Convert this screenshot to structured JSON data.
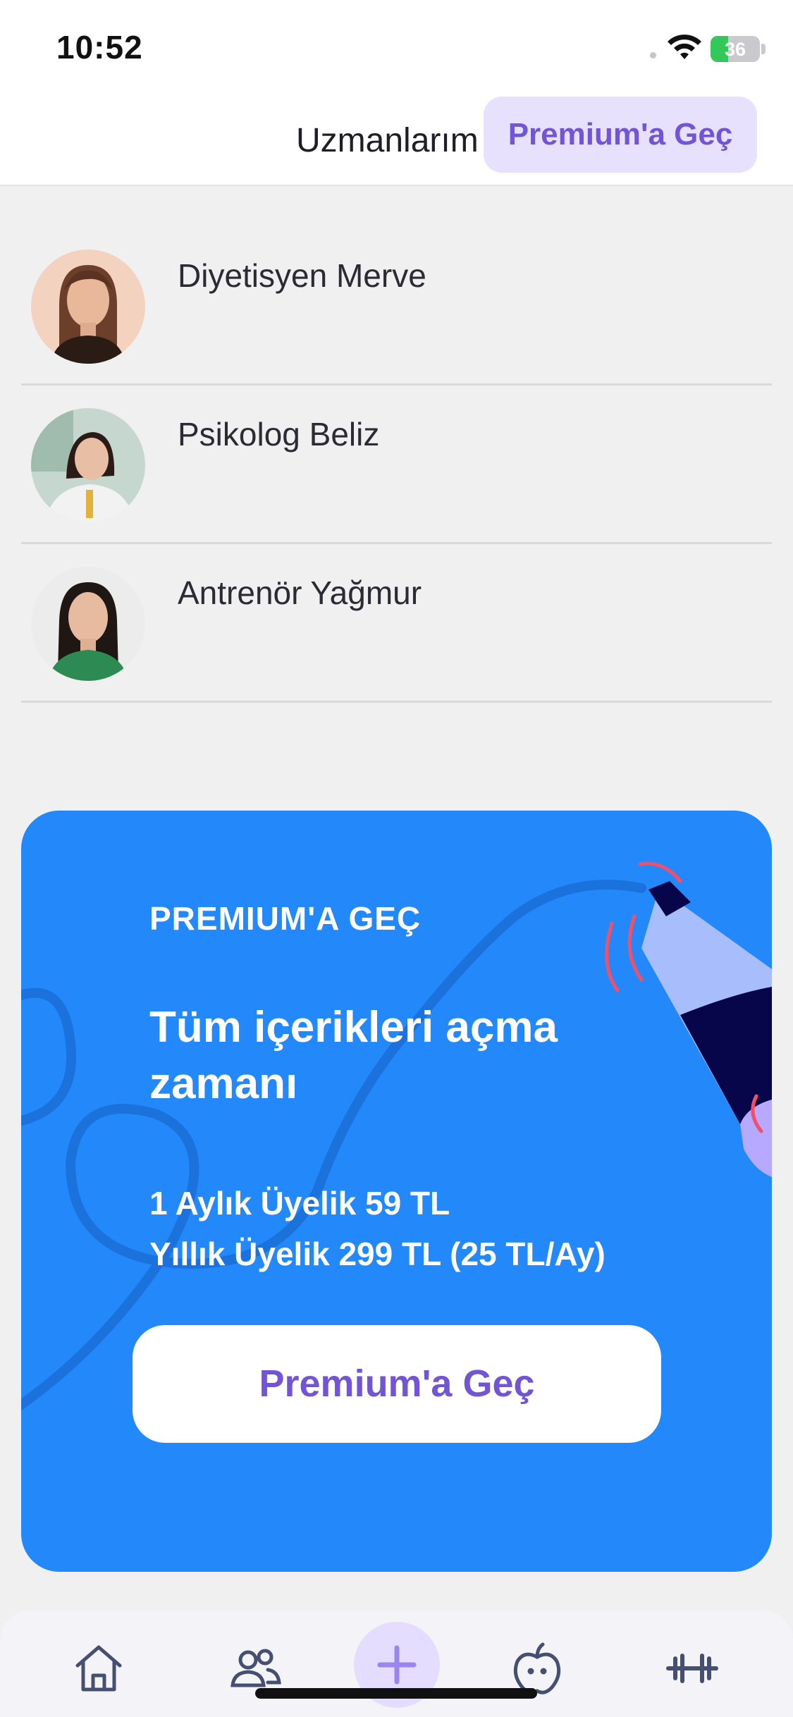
{
  "status_bar": {
    "time": "10:52",
    "battery_level": "36",
    "battery_fraction": 0.36,
    "icons": [
      "wifi-icon",
      "battery-charging-icon"
    ]
  },
  "nav": {
    "title": "Uzmanlarım",
    "premium_button": "Premium'a Geç"
  },
  "experts": [
    {
      "name": "Diyetisyen Merve"
    },
    {
      "name": "Psikolog Beliz"
    },
    {
      "name": "Antrenör Yağmur"
    }
  ],
  "premium_card": {
    "eyebrow": "PREMIUM'A GEÇ",
    "heading": "Tüm içerikleri açma zamanı",
    "monthly_price": "1 Aylık Üyelik 59 TL",
    "yearly_price": "Yıllık Üyelik 299 TL (25 TL/Ay)",
    "cta": "Premium'a Geç",
    "background_color": "#2389fb"
  },
  "tab_bar": {
    "tabs": [
      {
        "icon": "home-icon"
      },
      {
        "icon": "people-icon"
      },
      {
        "icon": "plus-icon"
      },
      {
        "icon": "apple-icon"
      },
      {
        "icon": "dumbbell-icon"
      }
    ]
  },
  "colors": {
    "accent_purple": "#7254d6",
    "accent_purple_light": "#e7e1fd",
    "tab_icon": "#454f72"
  }
}
